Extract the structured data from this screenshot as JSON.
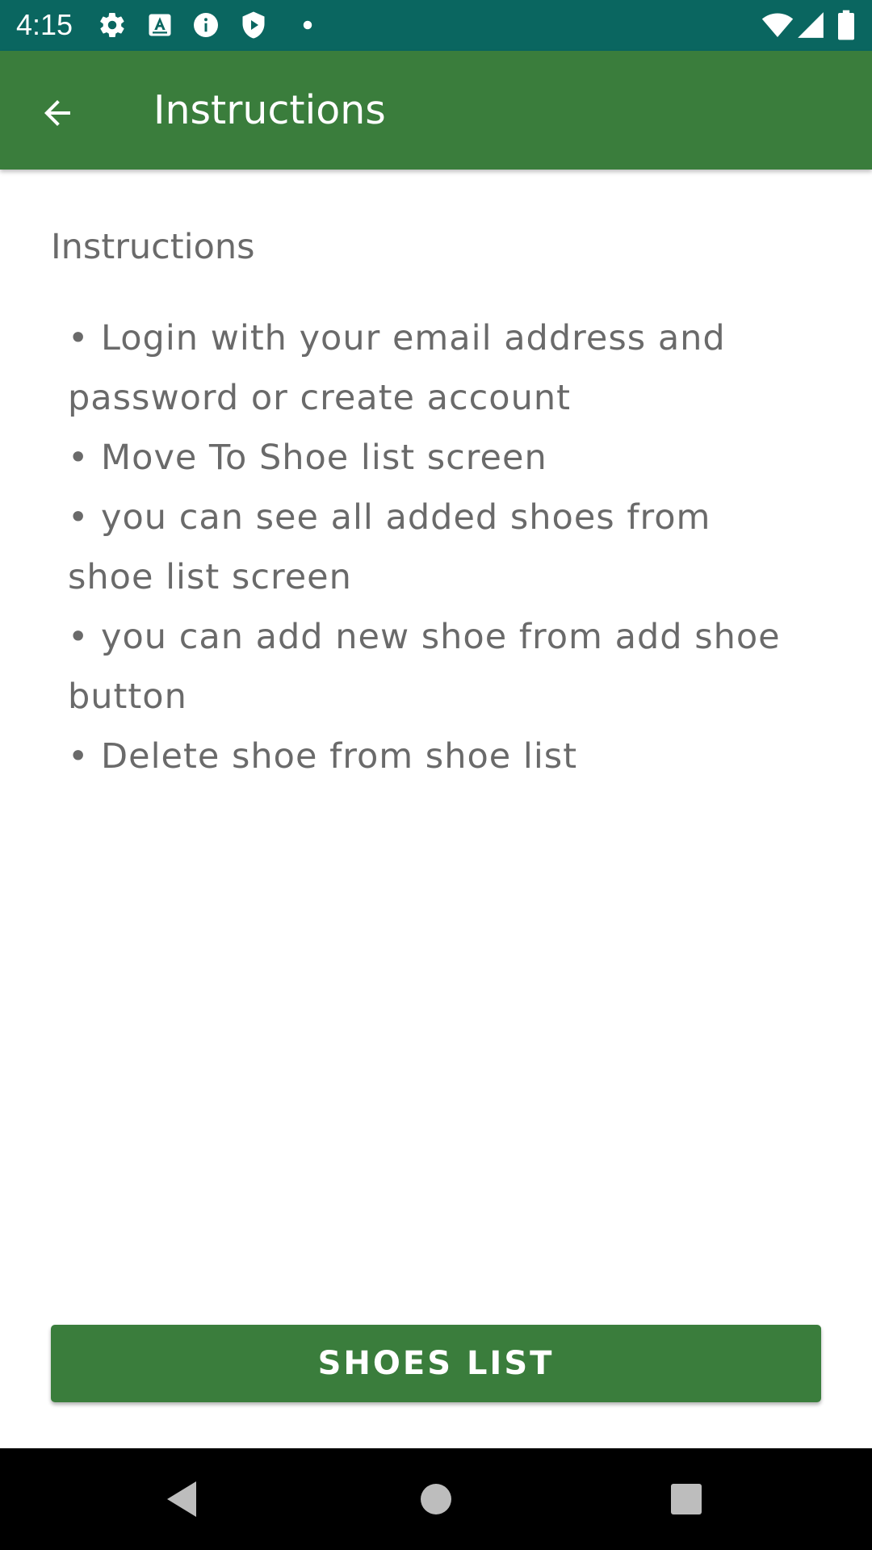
{
  "status_bar": {
    "time": "4:15",
    "left_icons": [
      "gear-icon",
      "keyboard-a-icon",
      "info-icon",
      "shield-play-icon",
      "dot-icon"
    ],
    "right_icons": [
      "wifi-icon",
      "signal-icon",
      "battery-icon"
    ],
    "background": "#0a6660"
  },
  "app_bar": {
    "back_icon": "arrow-back-icon",
    "title": "Instructions",
    "background": "#3a7d3c"
  },
  "content": {
    "heading": "Instructions",
    "text": "• Login with your email address and password or create account\n  • Move To Shoe list screen\n  • you can see all added shoes from shoe list screen\n  • you can add new shoe from add shoe button\n  • Delete shoe from shoe list",
    "text_color": "#6a6a6a"
  },
  "action_button": {
    "label": "SHOES LIST",
    "background": "#3a7d3c"
  },
  "nav_bar": {
    "buttons": [
      "back-triangle-icon",
      "home-circle-icon",
      "recents-square-icon"
    ]
  }
}
